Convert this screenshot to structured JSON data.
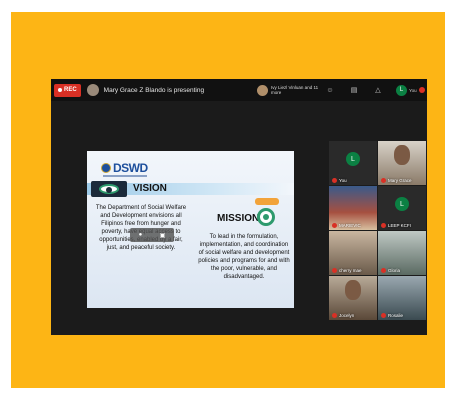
{
  "topbar": {
    "rec_label": "REC",
    "presenter_text": "Mary Grace Z Blando is presenting",
    "mini_participants": "Ivy Liezl Vinluan and 11 more",
    "tools": [
      {
        "icon": "people-icon",
        "label": ""
      },
      {
        "icon": "chat-icon",
        "label": ""
      },
      {
        "icon": "activities-icon",
        "label": ""
      }
    ],
    "you_initial": "L",
    "you_label": "You"
  },
  "slide": {
    "logo_text": "DSWD",
    "vision_title": "VISION",
    "vision_text": "The Department of Social Welfare and Development envisions all Filipinos free from hunger and poverty, have equal access to opportunities, enabled by a fair, just, and peaceful society.",
    "mission_title": "MISSION",
    "mission_text": "To lead in the formulation, implementation, and coordination of social welfare and development policies and programs for and with the poor, vulnerable, and disadvantaged."
  },
  "participants": [
    {
      "name": "You",
      "initial": "L",
      "video": false
    },
    {
      "name": "Mary Grace",
      "initial": "",
      "video": true
    },
    {
      "name": "MARIEVIC",
      "initial": "",
      "video": true
    },
    {
      "name": "LEEP KCFI",
      "initial": "L",
      "video": false
    },
    {
      "name": "cherry mae",
      "initial": "",
      "video": true
    },
    {
      "name": "Gloria",
      "initial": "",
      "video": true
    },
    {
      "name": "Jocelyn",
      "initial": "",
      "video": true
    },
    {
      "name": "Rosalie",
      "initial": "",
      "video": true
    }
  ],
  "colors": {
    "frame": "#FDB515",
    "meeting_bg": "#1b1b1b",
    "rec_red": "#d93025",
    "dswd_blue": "#1d4f9c",
    "accent_green": "#0b8043"
  }
}
